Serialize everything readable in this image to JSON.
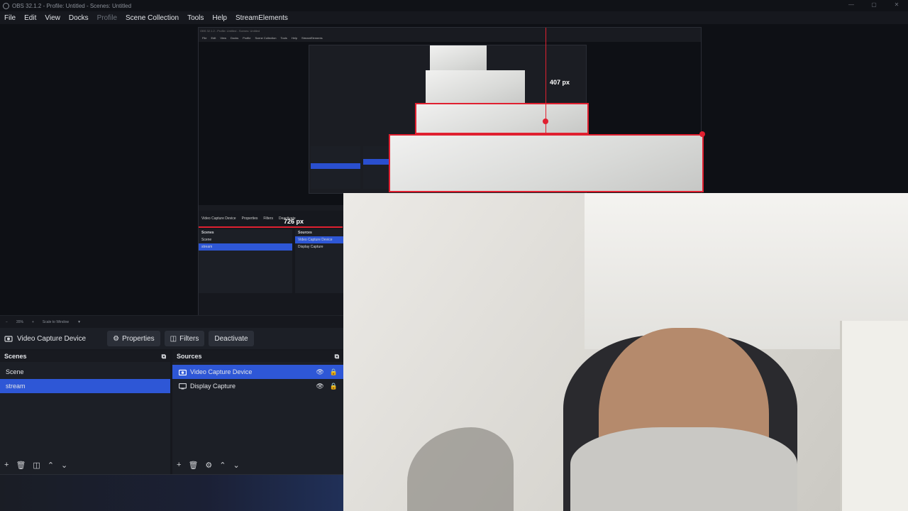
{
  "window": {
    "title": "OBS 32.1.2 - Profile: Untitled - Scenes: Untitled",
    "controls": [
      "—",
      "▢",
      "✕"
    ]
  },
  "menu": {
    "items": [
      "File",
      "Edit",
      "View",
      "Docks",
      "Profile",
      "Scene Collection",
      "Tools",
      "Help",
      "StreamElements"
    ]
  },
  "preview": {
    "nested_title": "OBS 32.1.2 - Profile: Untitled - Scenes: Untitled",
    "nested_menu": [
      "File",
      "Edit",
      "View",
      "Docks",
      "Profile",
      "Scene Collection",
      "Tools",
      "Help",
      "StreamElements"
    ],
    "measure_label_1": "407 px",
    "measure_label_2": "726 px",
    "nested_toolbar": [
      "Video Capture Device",
      "Properties",
      "Filters",
      "Deactivate"
    ],
    "nested_scenes_title": "Scenes",
    "nested_sources_title": "Sources",
    "nested_scenes": [
      "Scene",
      "stream"
    ],
    "nested_sources": [
      "Video Capture Device",
      "Display Capture"
    ]
  },
  "zoombar": {
    "zoom": "35%",
    "mode": "Scale to Window"
  },
  "toolbar": {
    "source_name": "Video Capture Device",
    "properties_label": "Properties",
    "filters_label": "Filters",
    "deactivate_label": "Deactivate"
  },
  "scenes": {
    "title": "Scenes",
    "items": [
      {
        "label": "Scene",
        "selected": false
      },
      {
        "label": "stream",
        "selected": true
      }
    ]
  },
  "sources": {
    "title": "Sources",
    "items": [
      {
        "label": "Video Capture Device",
        "icon": "camera-icon",
        "selected": true
      },
      {
        "label": "Display Capture",
        "icon": "monitor-icon",
        "selected": false
      }
    ]
  },
  "colors": {
    "accent": "#2e57d6",
    "measure_red": "#e02030",
    "background": "#16181e"
  }
}
